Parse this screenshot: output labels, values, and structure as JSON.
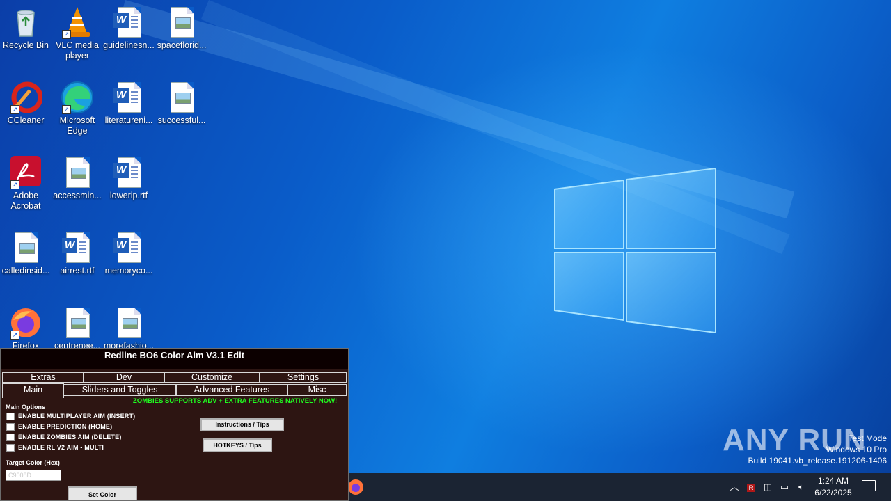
{
  "desktop": {
    "icons": [
      {
        "label": "Recycle Bin",
        "icon": "recycle-bin-icon"
      },
      {
        "label": "VLC media player",
        "icon": "vlc-icon"
      },
      {
        "label": "guidelinesn...",
        "icon": "word-doc-icon"
      },
      {
        "label": "spaceflorid...",
        "icon": "image-doc-icon"
      },
      {
        "label": "CCleaner",
        "icon": "ccleaner-icon"
      },
      {
        "label": "Microsoft Edge",
        "icon": "edge-icon"
      },
      {
        "label": "literatureni...",
        "icon": "word-doc-icon"
      },
      {
        "label": "successful...",
        "icon": "image-doc-icon"
      },
      {
        "label": "Adobe Acrobat",
        "icon": "acrobat-icon"
      },
      {
        "label": "accessmin...",
        "icon": "image-doc-icon"
      },
      {
        "label": "lowerip.rtf",
        "icon": "word-doc-icon"
      },
      {
        "label": "calledinsid...",
        "icon": "image-doc-icon"
      },
      {
        "label": "airrest.rtf",
        "icon": "word-doc-icon"
      },
      {
        "label": "memoryco...",
        "icon": "word-doc-icon"
      },
      {
        "label": "Firefox",
        "icon": "firefox-icon"
      },
      {
        "label": "centrenee...",
        "icon": "image-doc-icon"
      },
      {
        "label": "morefashio...",
        "icon": "image-doc-icon"
      }
    ]
  },
  "watermark": {
    "brand": "ANY RUN",
    "line1": "Test Mode",
    "line2": "Windows 10 Pro",
    "line3": "Build 19041.vb_release.191206-1406"
  },
  "taskbar": {
    "time": "1:24 AM",
    "date": "6/22/2025"
  },
  "app": {
    "title": "Redline BO6 Color Aim V3.1 Edit",
    "tabs_row1": [
      "Extras",
      "Dev",
      "Customize",
      "Settings"
    ],
    "tabs_row2": [
      "Main",
      "Sliders and Toggles",
      "Advanced Features",
      "Misc"
    ],
    "promo": "ZOMBIES SUPPORTS ADV + EXTRA FEATURES NATIVELY NOW!",
    "section_main": "Main Options",
    "options": [
      "ENABLE MULTIPLAYER AIM (INSERT)",
      "ENABLE PREDICTION (HOME)",
      "ENABLE ZOMBIES AIM (DELETE)",
      "ENABLE RL V2 AIM - MULTI"
    ],
    "target_color_label": "Target Color (Hex)",
    "target_color_value": "C9008D",
    "btn_instructions": "Instructions / Tips",
    "btn_hotkeys": "HOTKEYS / Tips",
    "btn_set_color": "Set Color"
  }
}
